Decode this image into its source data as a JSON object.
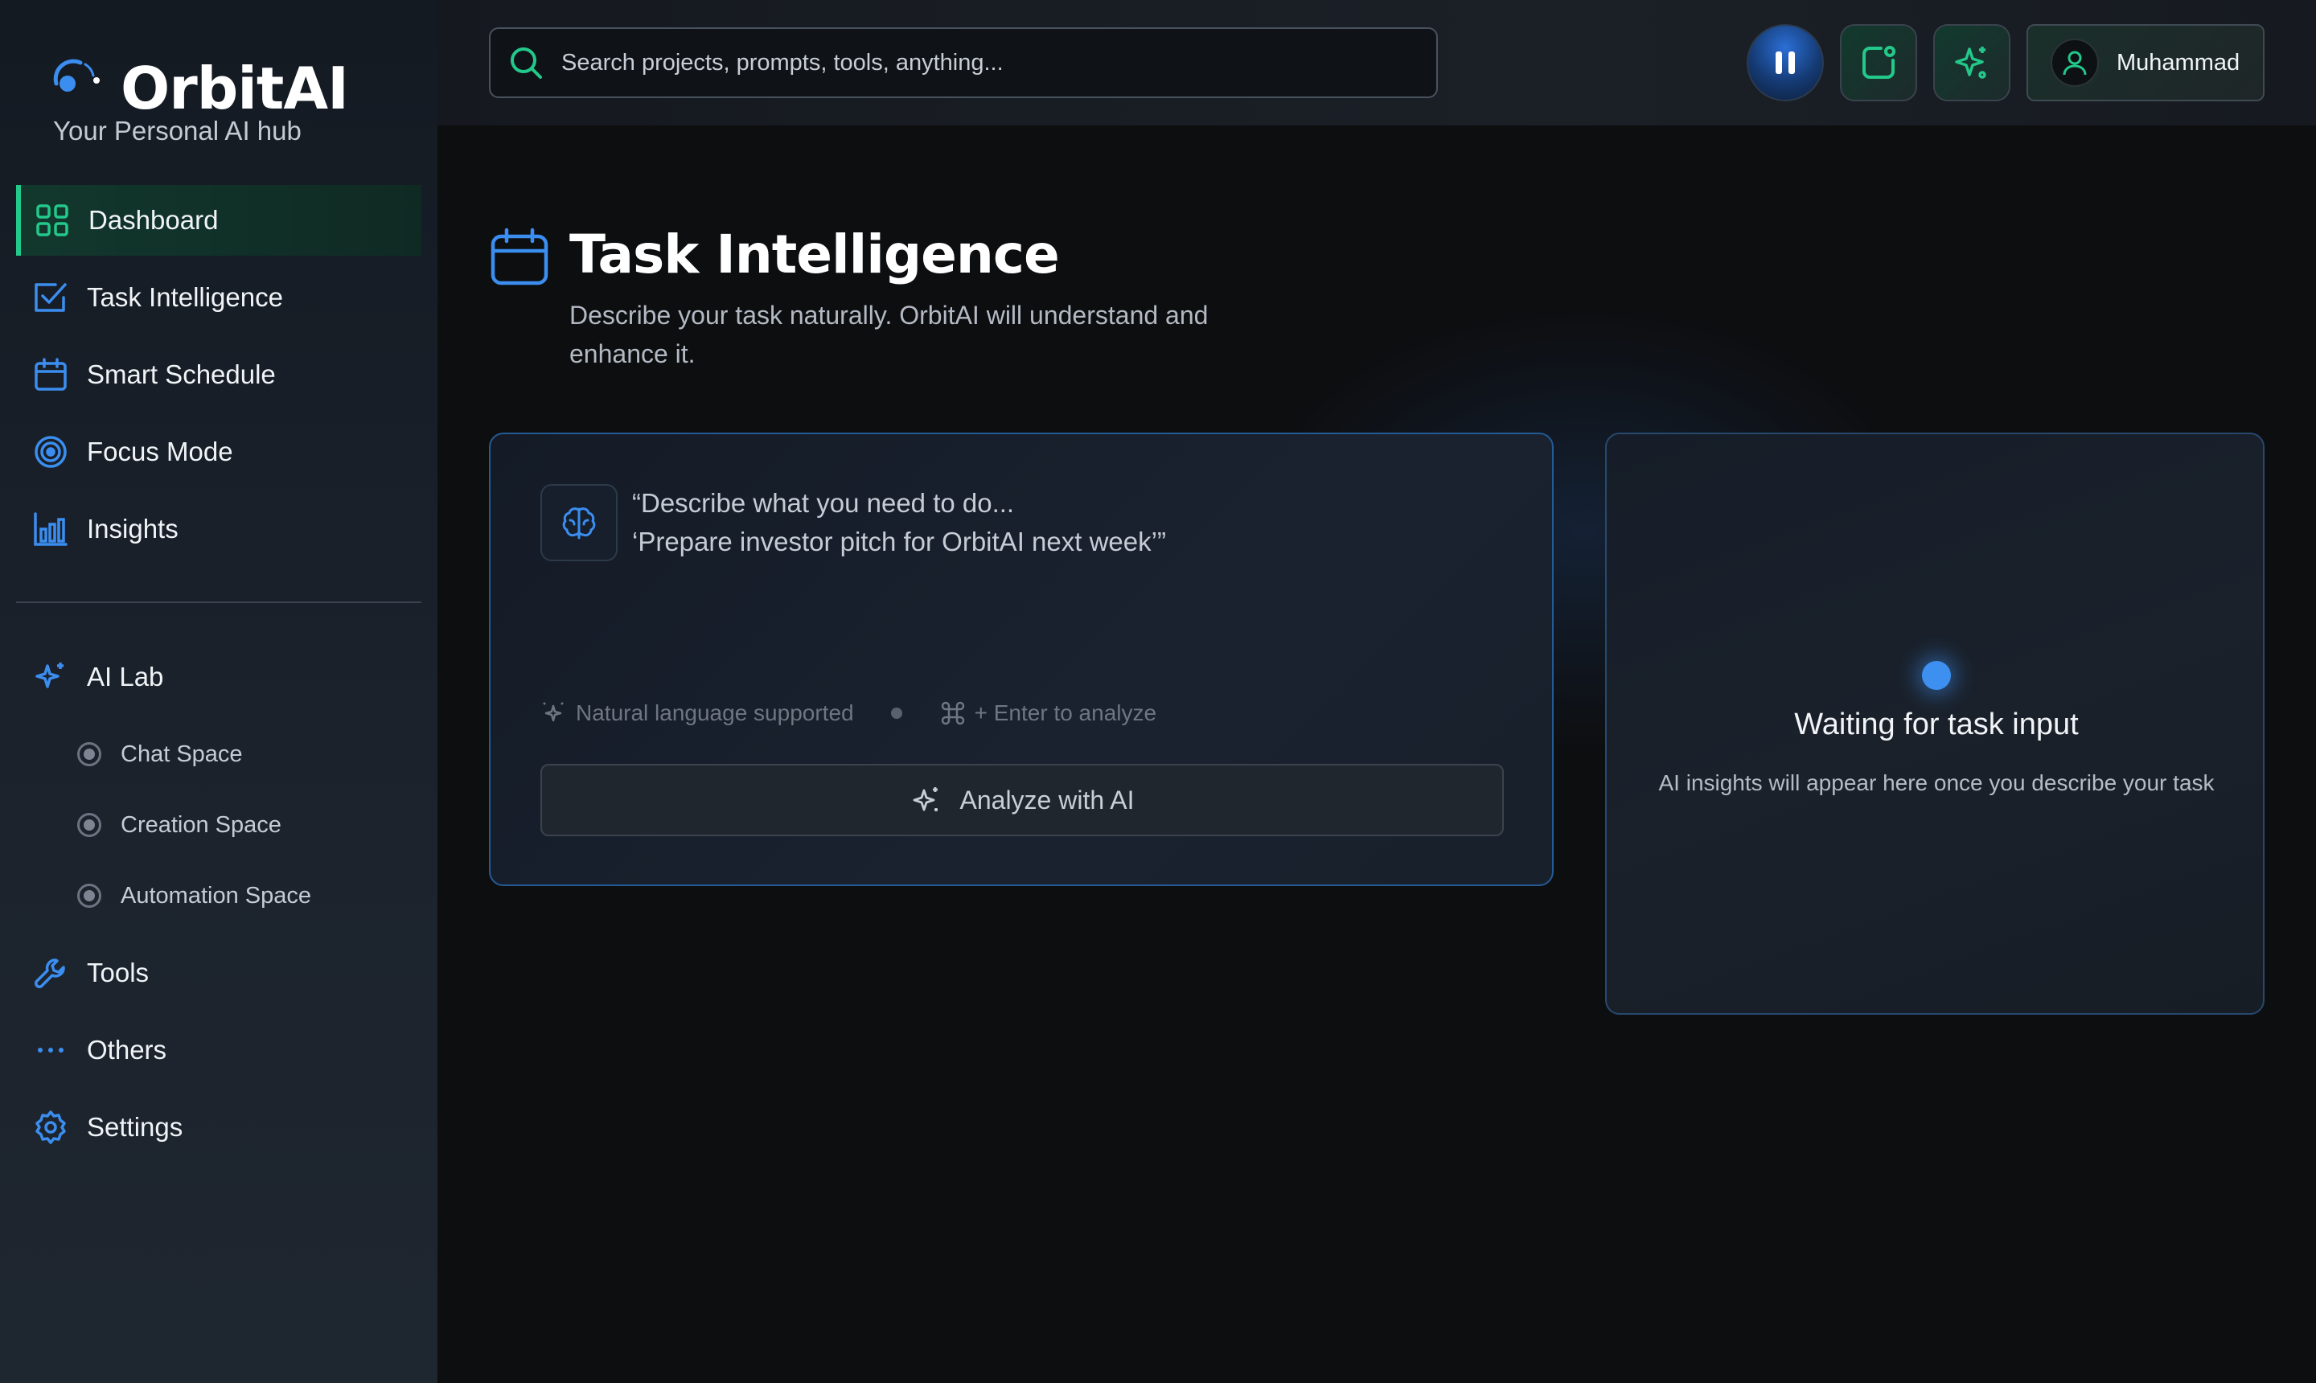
{
  "app": {
    "name": "OrbitAI",
    "tagline": "Your Personal AI hub"
  },
  "colors": {
    "accent_blue": "#3b8ef0",
    "accent_green": "#23c98b",
    "background": "#0d0e10"
  },
  "sidebar": {
    "items": [
      {
        "label": "Dashboard",
        "icon": "grid-icon",
        "active": true
      },
      {
        "label": "Task Intelligence",
        "icon": "checkbox-icon"
      },
      {
        "label": "Smart Schedule",
        "icon": "calendar-icon"
      },
      {
        "label": "Focus Mode",
        "icon": "target-icon"
      },
      {
        "label": "Insights",
        "icon": "bar-chart-icon"
      }
    ],
    "ai_lab": {
      "label": "AI Lab",
      "icon": "sparkle-icon",
      "children": [
        {
          "label": "Chat Space"
        },
        {
          "label": "Creation Space"
        },
        {
          "label": "Automation Space"
        }
      ]
    },
    "bottom_items": [
      {
        "label": "Tools",
        "icon": "wrench-icon"
      },
      {
        "label": "Others",
        "icon": "dots-icon"
      },
      {
        "label": "Settings",
        "icon": "gear-icon"
      }
    ]
  },
  "topbar": {
    "search_placeholder": "Search projects, prompts, tools, anything...",
    "user_name": "Muhammad"
  },
  "page": {
    "title": "Task Intelligence",
    "description": "Describe your task naturally. OrbitAI will understand and enhance it."
  },
  "task_input": {
    "placeholder_line1": "“Describe what you need to do...",
    "placeholder_line2": " ‘Prepare investor pitch for OrbitAI next week’”",
    "hint_natural": "Natural language supported",
    "hint_shortcut": "+ Enter to analyze",
    "analyze_label": "Analyze with AI"
  },
  "ai_panel": {
    "title": "Waiting for task input",
    "subtitle": "AI insights will appear here once you describe your task"
  }
}
